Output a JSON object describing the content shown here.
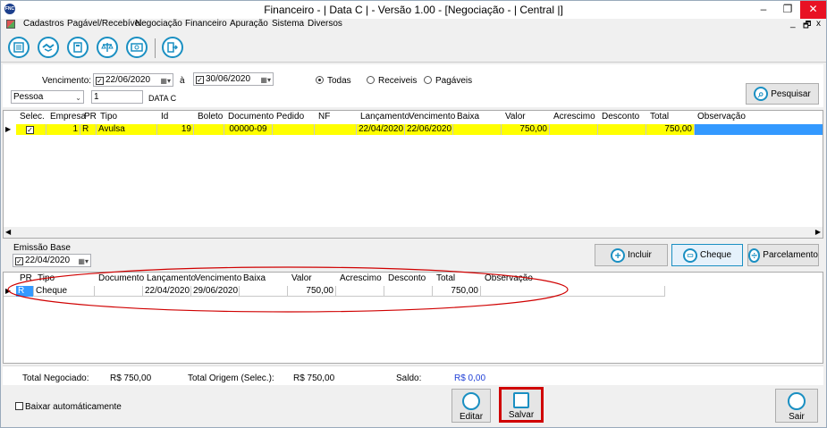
{
  "window": {
    "title": "Financeiro - | Data C | - Versão 1.00 - [Negociação - | Central |]",
    "logo_text": "FNC",
    "minimize_icon": "minimize-icon",
    "maximize_icon": "restore-icon",
    "close_icon": "close-icon"
  },
  "menu": {
    "items": [
      "Cadastros",
      "Pagável/Recebível",
      "Negociação",
      "Financeiro",
      "Apuração",
      "Sistema",
      "Diversos"
    ],
    "mdi_min": "_",
    "mdi_restore": "🗗",
    "mdi_close": "x"
  },
  "toolbar": {
    "icons": [
      "list-icon",
      "handshake-icon",
      "calculator-icon",
      "scale-icon",
      "money-icon",
      "exit-icon"
    ]
  },
  "filters": {
    "vencimento_label": "Vencimento:",
    "date_from": "22/06/2020",
    "a_label": "à",
    "date_to": "30/06/2020",
    "radio_todas": "Todas",
    "radio_receiveis": "Receiveis",
    "radio_pagaveis": "Pagáveis",
    "selected_radio": "Todas",
    "person_select": "Pessoa",
    "person_code": "1",
    "person_name": "DATA C",
    "search_button": "Pesquisar"
  },
  "top_grid": {
    "columns": [
      "Selec.",
      "Empresa",
      "PR",
      "Tipo",
      "Id",
      "Boleto",
      "Documento",
      "Pedido",
      "NF",
      "Lançamento",
      "Vencimento",
      "Baixa",
      "Valor",
      "Acrescimo",
      "Desconto",
      "Total",
      "Observação"
    ],
    "rows": [
      {
        "selec": "✓",
        "empresa": "1",
        "pr": "R",
        "tipo": "Avulsa",
        "id": "19",
        "boleto": "",
        "documento": "00000-09",
        "pedido": "",
        "nf": "",
        "lancamento": "22/04/2020",
        "vencimento": "22/06/2020",
        "baixa": "",
        "valor": "750,00",
        "acrescimo": "",
        "desconto": "",
        "total": "750,00",
        "observacao": ""
      }
    ]
  },
  "emissao": {
    "label": "Emissão Base",
    "date": "22/04/2020"
  },
  "actions": {
    "incluir": "Incluir",
    "cheque": "Cheque",
    "parcelamento": "Parcelamento"
  },
  "bottom_grid": {
    "columns": [
      "PR",
      "Tipo",
      "Documento",
      "Lançamento",
      "Vencimento",
      "Baixa",
      "Valor",
      "Acrescimo",
      "Desconto",
      "Total",
      "Observação"
    ],
    "rows": [
      {
        "pr": "R",
        "tipo": "Cheque",
        "documento": "",
        "lancamento": "22/04/2020",
        "vencimento": "29/06/2020",
        "baixa": "",
        "valor": "750,00",
        "acrescimo": "",
        "desconto": "",
        "total": "750,00",
        "observacao": ""
      }
    ]
  },
  "totals": {
    "negociado_label": "Total Negociado:",
    "negociado_value": "R$ 750,00",
    "origem_label": "Total Origem (Selec.):",
    "origem_value": "R$ 750,00",
    "saldo_label": "Saldo:",
    "saldo_value": "R$ 0,00"
  },
  "footer": {
    "baixar_auto": "Baixar automáticamente",
    "editar": "Editar",
    "salvar": "Salvar",
    "sair": "Sair"
  },
  "colors": {
    "highlight_row": "#ffff00",
    "selection_blue": "#3399ff",
    "annotation_red": "#d00000",
    "accent": "#1a8fc2",
    "saldo": "#1f3fd6"
  }
}
